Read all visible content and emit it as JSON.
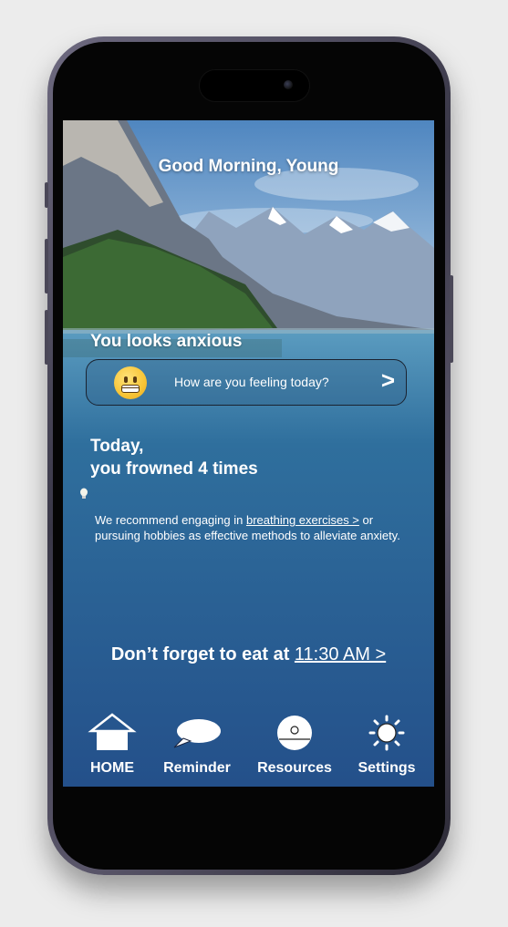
{
  "greeting": "Good Morning, Young",
  "mood_text": "You looks anxious",
  "feeling_prompt": "How are you feeling today?",
  "feeling_arrow": ">",
  "emoji_icon": "grimacing-face-icon",
  "frowned_line1": "Today,",
  "frowned_line2": "you frowned 4 times",
  "recommendation": {
    "prefix": "We recommend engaging in ",
    "link": "breathing exercises >",
    "suffix": " or pursuing hobbies as effective methods to alleviate anxiety."
  },
  "meal_reminder": {
    "text": "Don’t forget to eat at ",
    "time": "11:30 AM >"
  },
  "nav": [
    {
      "label": "HOME",
      "icon": "home-icon"
    },
    {
      "label": "Reminder",
      "icon": "speech-bubble-icon"
    },
    {
      "label": "Resources",
      "icon": "disc-icon"
    },
    {
      "label": "Settings",
      "icon": "sun-gear-icon"
    }
  ],
  "colors": {
    "accent": "#ffffff",
    "background_top": "#5d8fc4",
    "background_bottom": "#244c88"
  }
}
